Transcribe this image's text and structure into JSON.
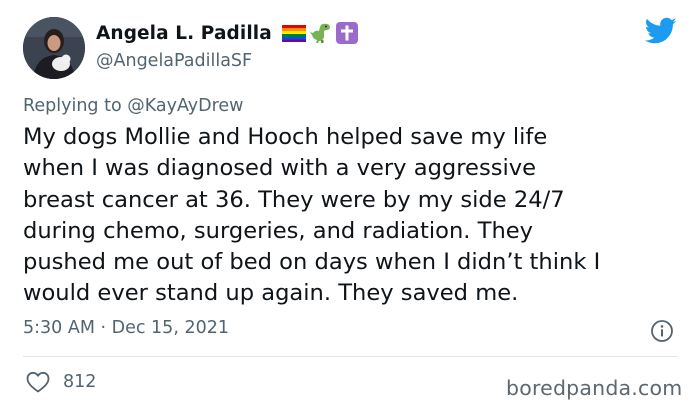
{
  "tweet": {
    "author": {
      "display_name": "Angela L. Padilla",
      "handle": "@AngelaPadillaSF",
      "name_emojis": [
        "rainbow-flag-icon",
        "dinosaur-icon",
        "cross-icon"
      ]
    },
    "reply_prefix": "Replying to ",
    "reply_to": "@KayAyDrew",
    "text": "My dogs Mollie and Hooch helped save my life\nwhen I was diagnosed with a very aggressive\nbreast cancer at 36.  They were by my side 24/7\nduring chemo, surgeries, and radiation.  They\npushed me out of bed on days when I didn’t think I\nwould ever stand up again.  They saved me.",
    "timestamp": "5:30 AM · Dec 15, 2021",
    "likes": "812"
  },
  "watermark": "boredpanda.com",
  "colors": {
    "brand_twitter": "#1d9bf0",
    "secondary_text": "#536471",
    "primary_text": "#0f1419"
  },
  "icons": {
    "logo": "twitter-bird-icon",
    "info": "info-icon",
    "like": "heart-icon"
  }
}
